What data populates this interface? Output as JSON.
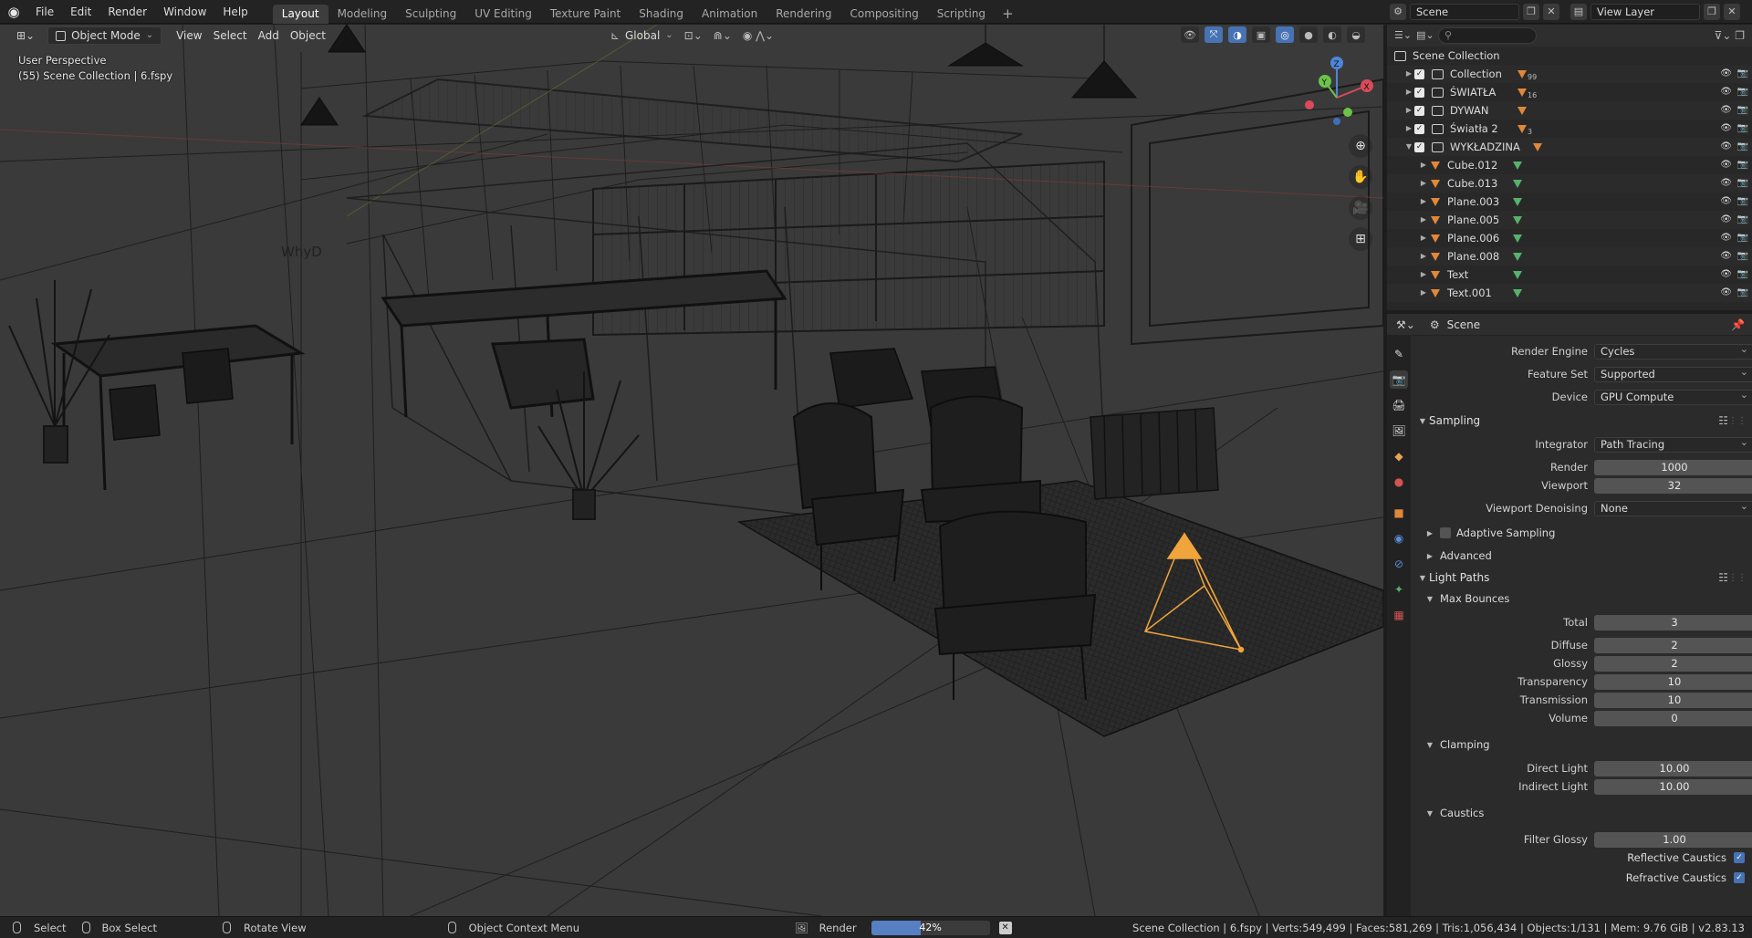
{
  "topbar": {
    "menus": [
      "File",
      "Edit",
      "Render",
      "Window",
      "Help"
    ],
    "workspaces": [
      "Layout",
      "Modeling",
      "Sculpting",
      "UV Editing",
      "Texture Paint",
      "Shading",
      "Animation",
      "Rendering",
      "Compositing",
      "Scripting"
    ],
    "active_workspace": "Layout",
    "scene_name": "Scene",
    "view_layer": "View Layer"
  },
  "viewport": {
    "mode": "Object Mode",
    "menus": [
      "View",
      "Select",
      "Add",
      "Object"
    ],
    "transform_orientation": "Global",
    "info_line1": "User Perspective",
    "info_line2": "(55) Scene Collection | 6.fspy",
    "gizmo_axes": [
      "X",
      "Y",
      "Z"
    ],
    "wall_text": "WhyD"
  },
  "outliner": {
    "root": "Scene Collection",
    "rows": [
      {
        "name": "Collection",
        "type": "collection",
        "badge": "99"
      },
      {
        "name": "ŚWIATŁA",
        "type": "collection",
        "badge": "16"
      },
      {
        "name": "DYWAN",
        "type": "collection",
        "badge": ""
      },
      {
        "name": "Światła 2",
        "type": "collection",
        "badge": "3"
      },
      {
        "name": "WYKŁADZINA",
        "type": "collection",
        "badge": ""
      },
      {
        "name": "Cube.012",
        "type": "mesh",
        "badge": ""
      },
      {
        "name": "Cube.013",
        "type": "mesh",
        "badge": ""
      },
      {
        "name": "Plane.003",
        "type": "mesh",
        "badge": ""
      },
      {
        "name": "Plane.005",
        "type": "mesh",
        "badge": ""
      },
      {
        "name": "Plane.006",
        "type": "mesh",
        "badge": ""
      },
      {
        "name": "Plane.008",
        "type": "mesh",
        "badge": ""
      },
      {
        "name": "Text",
        "type": "mesh",
        "badge": ""
      },
      {
        "name": "Text.001",
        "type": "mesh",
        "badge": ""
      }
    ]
  },
  "properties": {
    "context": "Scene",
    "render_engine_label": "Render Engine",
    "render_engine": "Cycles",
    "feature_set_label": "Feature Set",
    "feature_set": "Supported",
    "device_label": "Device",
    "device": "GPU Compute",
    "sampling": {
      "title": "Sampling",
      "integrator_label": "Integrator",
      "integrator": "Path Tracing",
      "render_label": "Render",
      "render": "1000",
      "viewport_label": "Viewport",
      "viewport": "32",
      "denoise_label": "Viewport Denoising",
      "denoise": "None",
      "adaptive_label": "Adaptive Sampling",
      "advanced_label": "Advanced"
    },
    "light_paths": {
      "title": "Light Paths",
      "max_bounces_title": "Max Bounces",
      "total_label": "Total",
      "total": "3",
      "diffuse_label": "Diffuse",
      "diffuse": "2",
      "glossy_label": "Glossy",
      "glossy": "2",
      "transparency_label": "Transparency",
      "transparency": "10",
      "transmission_label": "Transmission",
      "transmission": "10",
      "volume_label": "Volume",
      "volume": "0",
      "clamping_title": "Clamping",
      "direct_label": "Direct Light",
      "direct": "10.00",
      "indirect_label": "Indirect Light",
      "indirect": "10.00",
      "caustics_title": "Caustics",
      "filter_glossy_label": "Filter Glossy",
      "filter_glossy": "1.00",
      "reflective_label": "Reflective Caustics",
      "refractive_label": "Refractive Caustics"
    }
  },
  "statusbar": {
    "select": "Select",
    "box_select": "Box Select",
    "rotate_view": "Rotate View",
    "context_menu": "Object Context Menu",
    "render_label": "Render",
    "render_progress_text": "42%",
    "render_progress": 0.42,
    "stats": "Scene Collection | 6.fspy | Verts:549,499 | Faces:581,269 | Tris:1,056,434 | Objects:1/131 | Mem: 9.76 GiB | v2.83.13"
  },
  "colors": {
    "accent": "#4772b3",
    "selected_object": "#f0a43c",
    "mesh_icon": "#56b26a",
    "object_icon": "#e0883a"
  }
}
